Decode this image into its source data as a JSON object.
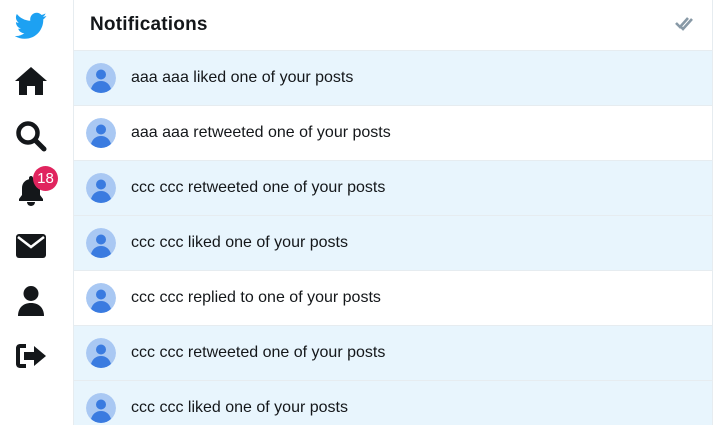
{
  "sidebar": {
    "items": [
      {
        "name": "logo",
        "icon": "twitter-bird-icon"
      },
      {
        "name": "home",
        "icon": "home-icon"
      },
      {
        "name": "explore",
        "icon": "search-icon"
      },
      {
        "name": "notifications",
        "icon": "bell-icon",
        "badge": "18"
      },
      {
        "name": "messages",
        "icon": "envelope-icon"
      },
      {
        "name": "profile",
        "icon": "user-icon"
      },
      {
        "name": "logout",
        "icon": "sign-out-icon"
      }
    ],
    "notification_badge": "18"
  },
  "header": {
    "title": "Notifications",
    "mark_read_icon": "double-check-icon"
  },
  "notifications": [
    {
      "text": "aaa aaa liked one of your posts",
      "unread": true
    },
    {
      "text": "aaa aaa retweeted one of your posts",
      "unread": false
    },
    {
      "text": "ccc ccc retweeted one of your posts",
      "unread": true
    },
    {
      "text": "ccc ccc liked one of your posts",
      "unread": true
    },
    {
      "text": "ccc ccc replied to one of your posts",
      "unread": false
    },
    {
      "text": "ccc ccc retweeted one of your posts",
      "unread": true
    },
    {
      "text": "ccc ccc liked one of your posts",
      "unread": true
    }
  ],
  "colors": {
    "brand": "#1da1f2",
    "icon": "#14171a",
    "badge": "#e0245e",
    "unread_bg": "#e8f5fd",
    "avatar_bg": "#a9c8f3",
    "avatar_fg": "#3a7be0"
  }
}
